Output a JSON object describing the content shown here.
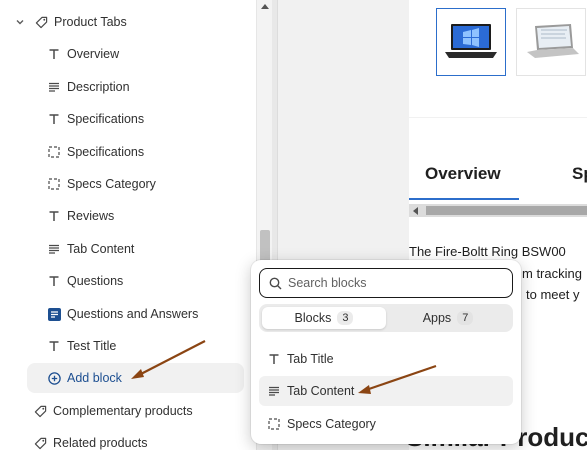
{
  "sidebar": {
    "section_title": "Product Tabs",
    "items": [
      {
        "label": "Overview",
        "icon": "text-icon"
      },
      {
        "label": "Description",
        "icon": "paragraph-icon"
      },
      {
        "label": "Specifications",
        "icon": "text-icon"
      },
      {
        "label": "Specifications",
        "icon": "dashed-box-icon"
      },
      {
        "label": "Specs Category",
        "icon": "dashed-box-icon"
      },
      {
        "label": "Reviews",
        "icon": "text-icon"
      },
      {
        "label": "Tab Content",
        "icon": "paragraph-icon"
      },
      {
        "label": "Questions",
        "icon": "text-icon"
      },
      {
        "label": "Questions and Answers",
        "icon": "app-icon"
      },
      {
        "label": "Test Title",
        "icon": "text-icon"
      }
    ],
    "add_block_label": "Add block",
    "sections": [
      {
        "label": "Complementary products"
      },
      {
        "label": "Related products"
      }
    ]
  },
  "preview": {
    "tab_overview": "Overview",
    "tab_next": "Sp",
    "text_line1": "The Fire-Boltt Ring BSW00",
    "text_line2": "m tracking",
    "text_line3": "to meet y",
    "bottom_heading": "Similar Produc"
  },
  "block_picker": {
    "search_placeholder": "Search blocks",
    "tabs": [
      {
        "label": "Blocks",
        "count": "3",
        "active": true
      },
      {
        "label": "Apps",
        "count": "7",
        "active": false
      }
    ],
    "items": [
      {
        "label": "Tab Title",
        "icon": "text-icon"
      },
      {
        "label": "Tab Content",
        "icon": "paragraph-icon"
      },
      {
        "label": "Specs Category",
        "icon": "dashed-box-icon"
      }
    ]
  },
  "colors": {
    "accent": "#2c6ecb",
    "annotation_arrow": "#8b4513"
  }
}
